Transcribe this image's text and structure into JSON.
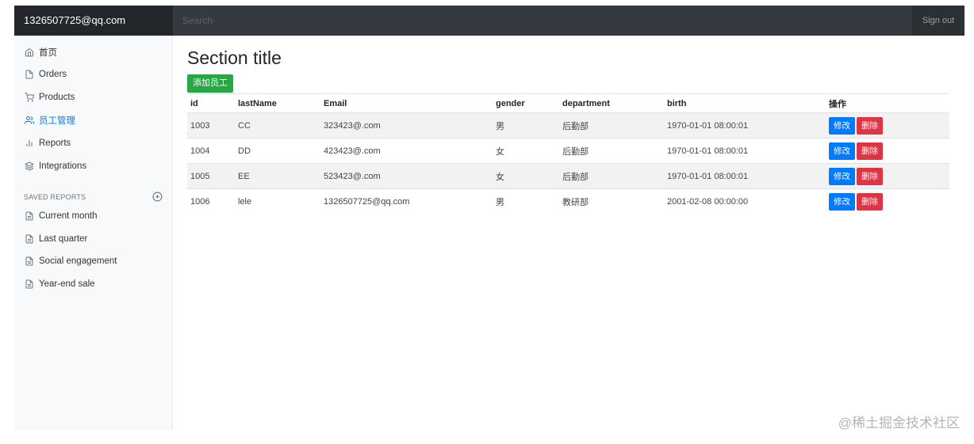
{
  "navbar": {
    "brand": "1326507725@qq.com",
    "search_placeholder": "Search",
    "signout_label": "Sign out"
  },
  "sidebar": {
    "items": [
      {
        "label": "首页",
        "icon": "home-icon"
      },
      {
        "label": "Orders",
        "icon": "file-icon"
      },
      {
        "label": "Products",
        "icon": "shopping-cart-icon"
      },
      {
        "label": "员工管理",
        "icon": "users-icon",
        "active": true
      },
      {
        "label": "Reports",
        "icon": "bar-chart-icon"
      },
      {
        "label": "Integrations",
        "icon": "layers-icon"
      }
    ],
    "saved_heading": "SAVED REPORTS",
    "saved_items": [
      {
        "label": "Current month",
        "icon": "file-text-icon"
      },
      {
        "label": "Last quarter",
        "icon": "file-text-icon"
      },
      {
        "label": "Social engagement",
        "icon": "file-text-icon"
      },
      {
        "label": "Year-end sale",
        "icon": "file-text-icon"
      }
    ]
  },
  "main": {
    "title": "Section title",
    "add_button": "添加员工",
    "columns": [
      "id",
      "lastName",
      "Email",
      "gender",
      "department",
      "birth",
      "操作"
    ],
    "rows": [
      {
        "id": "1003",
        "lastName": "CC",
        "email": "323423@.com",
        "gender": "男",
        "department": "后勤部",
        "birth": "1970-01-01 08:00:01"
      },
      {
        "id": "1004",
        "lastName": "DD",
        "email": "423423@.com",
        "gender": "女",
        "department": "后勤部",
        "birth": "1970-01-01 08:00:01"
      },
      {
        "id": "1005",
        "lastName": "EE",
        "email": "523423@.com",
        "gender": "女",
        "department": "后勤部",
        "birth": "1970-01-01 08:00:01"
      },
      {
        "id": "1006",
        "lastName": "lele",
        "email": "1326507725@qq.com",
        "gender": "男",
        "department": "教研部",
        "birth": "2001-02-08 00:00:00"
      }
    ],
    "edit_label": "修改",
    "delete_label": "删除"
  },
  "watermark": "@稀土掘金技术社区",
  "colors": {
    "accent": "#007bff",
    "success": "#28a745",
    "danger": "#dc3545",
    "navbar": "#343a40"
  }
}
